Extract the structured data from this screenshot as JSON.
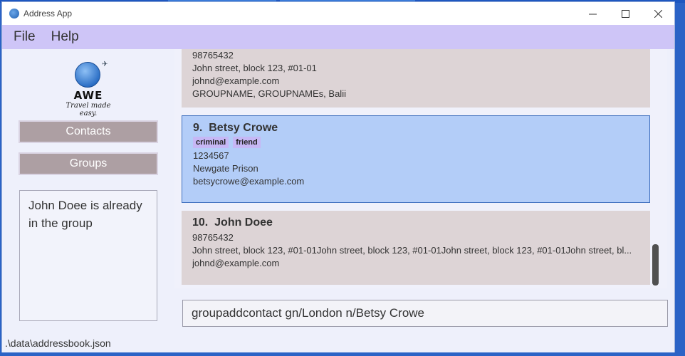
{
  "window": {
    "title": "Address App",
    "controls": {
      "minimize_icon": "minimize-icon",
      "maximize_icon": "maximize-icon",
      "close_icon": "close-icon"
    }
  },
  "menu": {
    "file": "File",
    "help": "Help"
  },
  "sidebar": {
    "logo": {
      "brand": "AWE",
      "tagline": "Travel made easy."
    },
    "contacts_button": "Contacts",
    "groups_button": "Groups",
    "result_message": "John Doee is already in the group"
  },
  "contacts": [
    {
      "phone": "98765432",
      "address": "John street, block 123, #01-01",
      "email": "johnd@example.com",
      "groups": "GROUPNAME, GROUPNAMEs, Balii"
    },
    {
      "index": "9.",
      "name": "Betsy Crowe",
      "tags": [
        "criminal",
        "friend"
      ],
      "phone": "1234567",
      "address": "Newgate Prison",
      "email": "betsycrowe@example.com"
    },
    {
      "index": "10.",
      "name": "John Doee",
      "phone": "98765432",
      "address": "John street, block 123, #01-01John street, block 123, #01-01John street, block 123, #01-01John street, bl...",
      "email": "johnd@example.com"
    }
  ],
  "command": {
    "value": "groupaddcontact gn/London n/Betsy Crowe"
  },
  "status": {
    "file_path": ".\\data\\addressbook.json"
  },
  "colors": {
    "menubar": "#cec5f7",
    "card": "#ddd4d6",
    "card_selected": "#b3cdf8",
    "tag": "#c6b7f5",
    "sidebar_button": "#ad9fa3"
  }
}
